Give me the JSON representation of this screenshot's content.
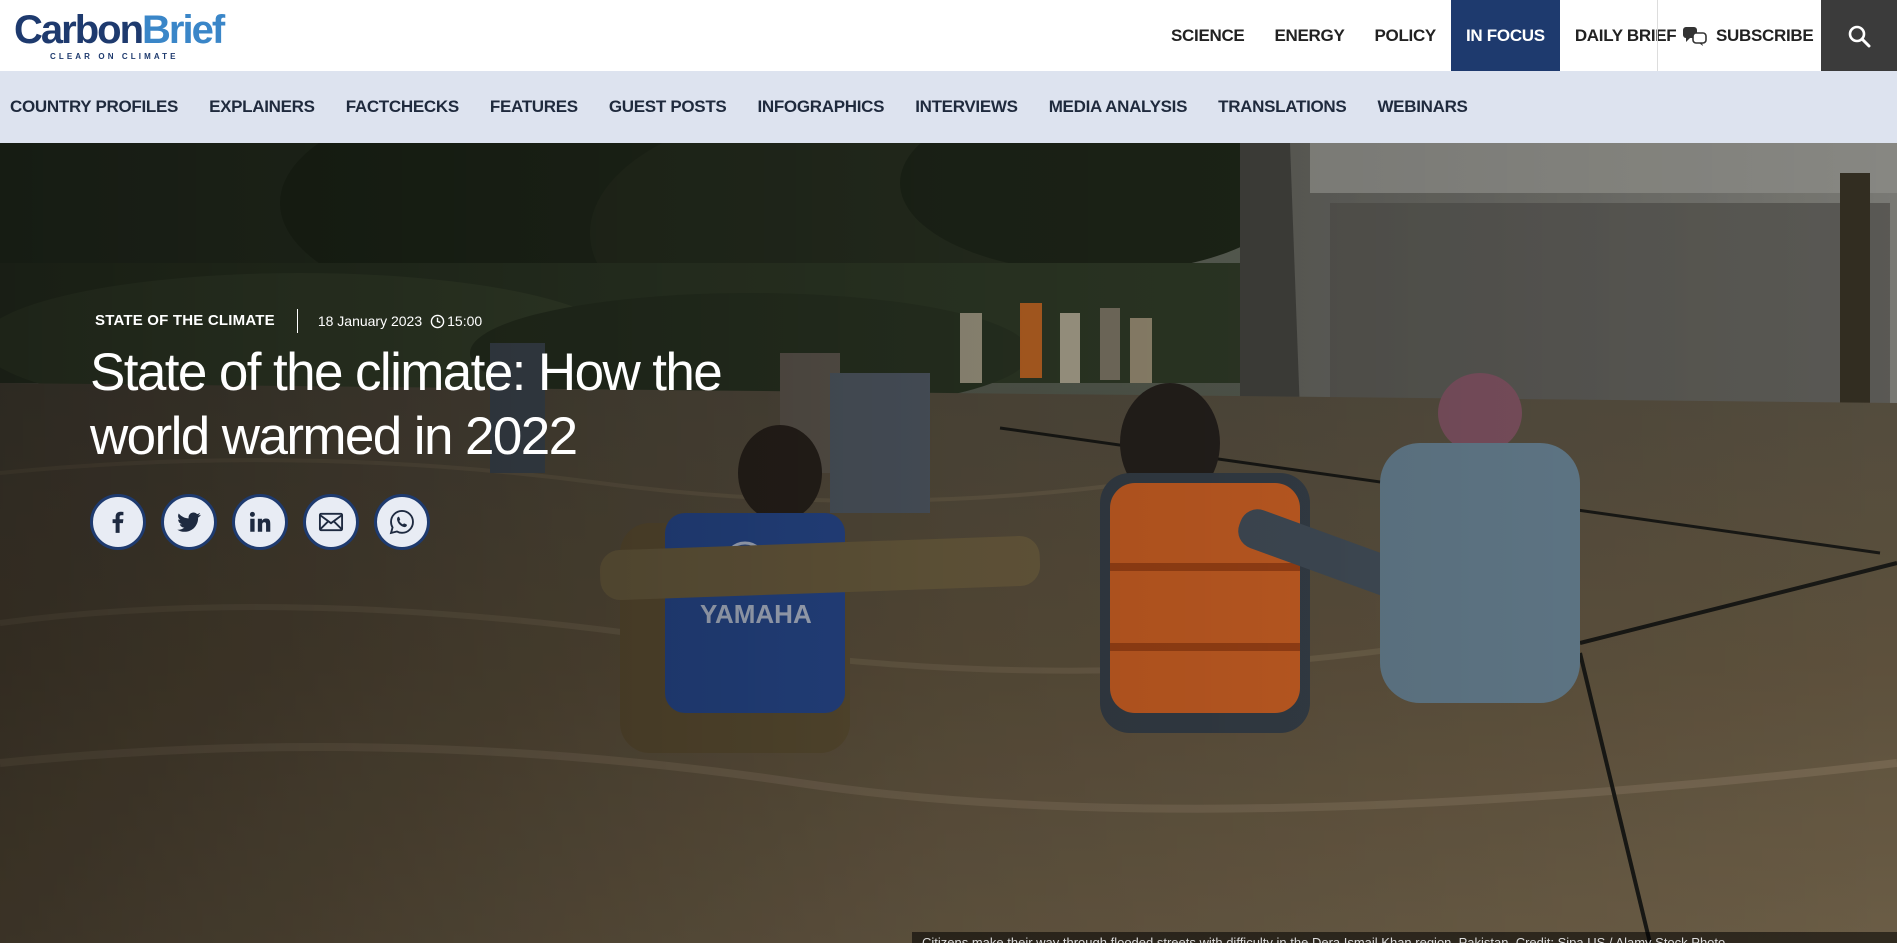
{
  "brand": {
    "name_part1": "Carbon",
    "name_part2": "Brief",
    "tagline": "CLEAR ON CLIMATE",
    "colors": {
      "primary": "#1e3a6e",
      "accent": "#3a86c8",
      "subnav_bg": "#dde3ef"
    }
  },
  "main_nav": [
    {
      "label": "SCIENCE",
      "active": false
    },
    {
      "label": "ENERGY",
      "active": false
    },
    {
      "label": "POLICY",
      "active": false
    },
    {
      "label": "IN FOCUS",
      "active": true
    },
    {
      "label": "DAILY BRIEF",
      "active": false
    }
  ],
  "subscribe": {
    "label": "SUBSCRIBE",
    "icon": "subscribe-icon"
  },
  "search": {
    "icon": "search-icon"
  },
  "sub_nav": [
    "COUNTRY PROFILES",
    "EXPLAINERS",
    "FACTCHECKS",
    "FEATURES",
    "GUEST POSTS",
    "INFOGRAPHICS",
    "INTERVIEWS",
    "MEDIA ANALYSIS",
    "TRANSLATIONS",
    "WEBINARS"
  ],
  "article": {
    "category": "STATE OF THE CLIMATE",
    "date": "18 January 2023",
    "time": "15:00",
    "title": "State of the climate: How the world warmed in 2022",
    "share": [
      {
        "name": "facebook",
        "icon": "facebook-icon"
      },
      {
        "name": "twitter",
        "icon": "twitter-icon"
      },
      {
        "name": "linkedin",
        "icon": "linkedin-icon"
      },
      {
        "name": "email",
        "icon": "email-icon"
      },
      {
        "name": "whatsapp",
        "icon": "whatsapp-icon"
      }
    ],
    "image_caption": "Citizens make their way through flooded streets with difficulty in the Dera Ismail Khan region, Pakistan. Credit: Sipa US / Alamy Stock Photo"
  }
}
